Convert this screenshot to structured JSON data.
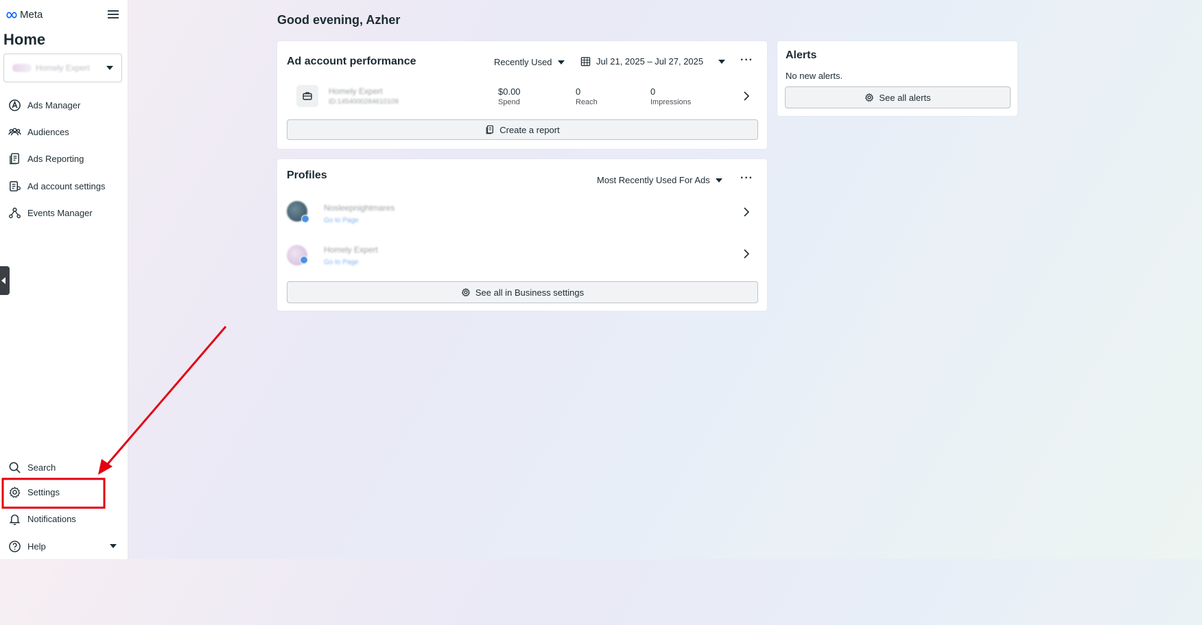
{
  "brand": {
    "name": "Meta"
  },
  "sidebar": {
    "title": "Home",
    "account_name": "Homely Expert",
    "items": [
      {
        "label": "Ads Manager"
      },
      {
        "label": "Audiences"
      },
      {
        "label": "Ads Reporting"
      },
      {
        "label": "Ad account settings"
      },
      {
        "label": "Events Manager"
      }
    ],
    "bottom_items": [
      {
        "label": "Search"
      },
      {
        "label": "Settings"
      },
      {
        "label": "Notifications"
      },
      {
        "label": "Help"
      }
    ]
  },
  "main": {
    "greeting": "Good evening, Azher",
    "performance": {
      "title": "Ad account performance",
      "sort_label": "Recently Used",
      "date_range": "Jul 21, 2025 – Jul 27, 2025",
      "account_name": "Homely Expert",
      "account_id": "ID:1454000284610109",
      "metrics": [
        {
          "value": "$0.00",
          "label": "Spend"
        },
        {
          "value": "0",
          "label": "Reach"
        },
        {
          "value": "0",
          "label": "Impressions"
        }
      ],
      "create_report_label": "Create a report"
    },
    "profiles": {
      "title": "Profiles",
      "sort_label": "Most Recently Used For Ads",
      "items": [
        {
          "name": "Nosleepnightmares",
          "link": "Go to Page"
        },
        {
          "name": "Homely Expert",
          "link": "Go to Page"
        }
      ],
      "business_settings_label": "See all in Business settings"
    },
    "alerts": {
      "title": "Alerts",
      "message": "No new alerts.",
      "see_all_label": "See all alerts"
    }
  },
  "colors": {
    "annotation_red": "#e3000f",
    "text": "#1c2b33",
    "button_bg": "#f1f3f5"
  }
}
